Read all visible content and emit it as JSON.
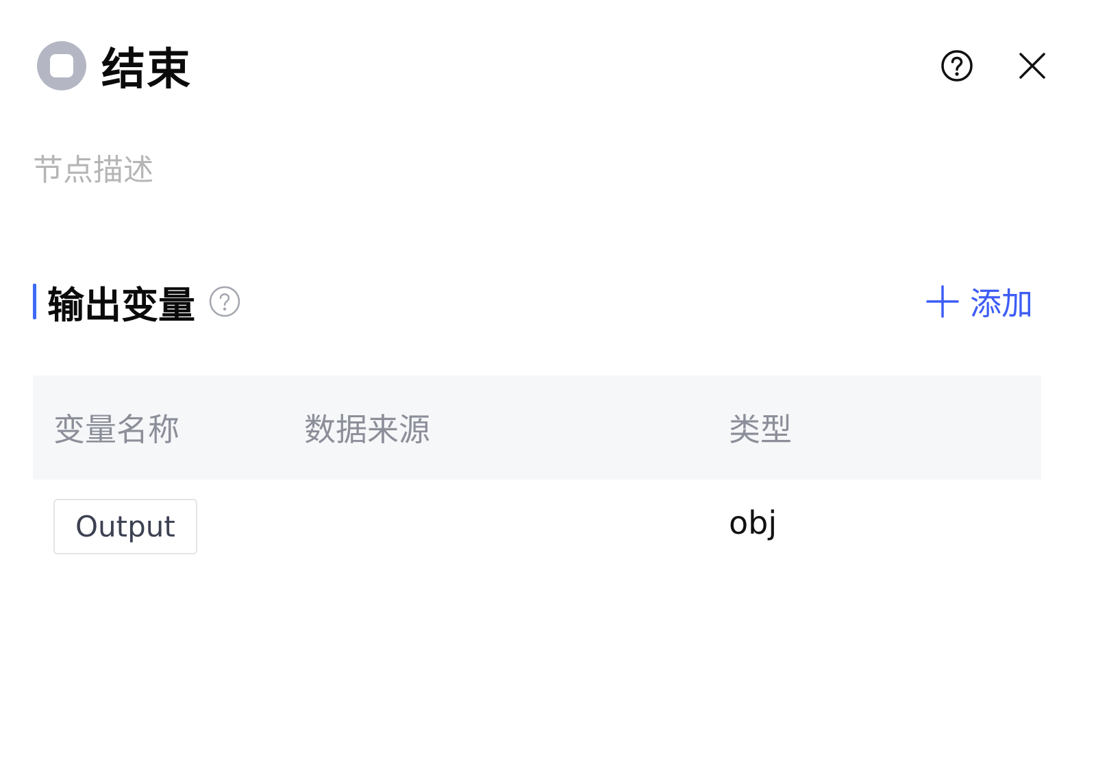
{
  "header": {
    "title": "结束",
    "icons": {
      "node": "stop-circle-icon",
      "help": "help-circle-icon",
      "close": "close-icon"
    }
  },
  "description": {
    "placeholder": "节点描述"
  },
  "output_section": {
    "title": "输出变量",
    "help_icon": "help-circle-icon",
    "add_label": "添加",
    "accent_color": "#3d6bf6"
  },
  "table": {
    "columns": [
      "变量名称",
      "数据来源",
      "类型"
    ],
    "rows": [
      {
        "name": "Output",
        "source": "",
        "type": "obj"
      }
    ]
  }
}
